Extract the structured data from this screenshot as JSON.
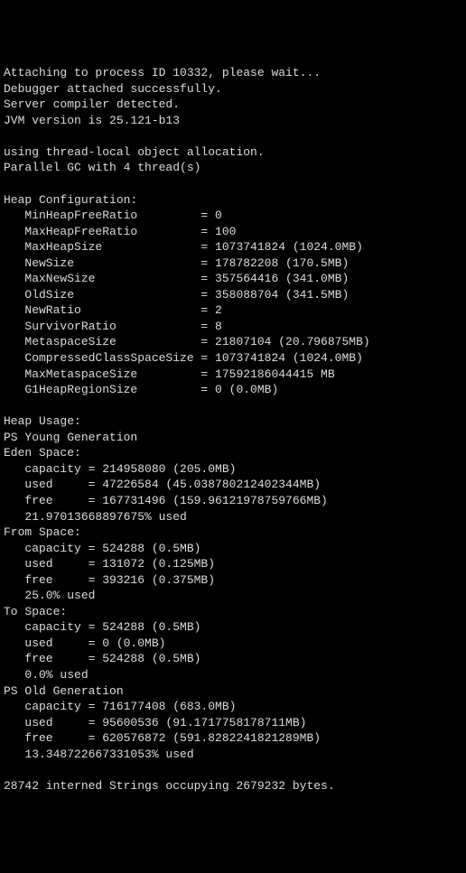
{
  "header": {
    "attach": "Attaching to process ID 10332, please wait...",
    "attached": "Debugger attached successfully.",
    "compiler": "Server compiler detected.",
    "jvm": "JVM version is 25.121-b13",
    "tloa": "using thread-local object allocation.",
    "gc": "Parallel GC with 4 thread(s)"
  },
  "heap_config": {
    "title": "Heap Configuration:",
    "items": [
      {
        "name": "MinHeapFreeRatio",
        "value": "0"
      },
      {
        "name": "MaxHeapFreeRatio",
        "value": "100"
      },
      {
        "name": "MaxHeapSize",
        "value": "1073741824 (1024.0MB)"
      },
      {
        "name": "NewSize",
        "value": "178782208 (170.5MB)"
      },
      {
        "name": "MaxNewSize",
        "value": "357564416 (341.0MB)"
      },
      {
        "name": "OldSize",
        "value": "358088704 (341.5MB)"
      },
      {
        "name": "NewRatio",
        "value": "2"
      },
      {
        "name": "SurvivorRatio",
        "value": "8"
      },
      {
        "name": "MetaspaceSize",
        "value": "21807104 (20.796875MB)"
      },
      {
        "name": "CompressedClassSpaceSize",
        "value": "1073741824 (1024.0MB)"
      },
      {
        "name": "MaxMetaspaceSize",
        "value": "17592186044415 MB"
      },
      {
        "name": "G1HeapRegionSize",
        "value": "0 (0.0MB)"
      }
    ]
  },
  "heap_usage": {
    "title": "Heap Usage:",
    "young_gen": "PS Young Generation",
    "eden": {
      "title": "Eden Space:",
      "capacity": "214958080 (205.0MB)",
      "used": "47226584 (45.038780212402344MB)",
      "free": "167731496 (159.96121978759766MB)",
      "pct": "21.97013668897675% used"
    },
    "from": {
      "title": "From Space:",
      "capacity": "524288 (0.5MB)",
      "used": "131072 (0.125MB)",
      "free": "393216 (0.375MB)",
      "pct": "25.0% used"
    },
    "to": {
      "title": "To Space:",
      "capacity": "524288 (0.5MB)",
      "used": "0 (0.0MB)",
      "free": "524288 (0.5MB)",
      "pct": "0.0% used"
    },
    "old_gen": {
      "title": "PS Old Generation",
      "capacity": "716177408 (683.0MB)",
      "used": "95600536 (91.1717758178711MB)",
      "free": "620576872 (591.8282241821289MB)",
      "pct": "13.348722667331053% used"
    }
  },
  "footer": {
    "interned": "28742 interned Strings occupying 2679232 bytes."
  },
  "fmt": {
    "cfg_name_width": 24,
    "space_label_width": 8
  }
}
